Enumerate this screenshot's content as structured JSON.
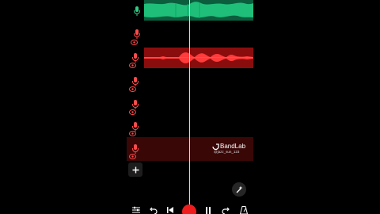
{
  "app": {
    "name": "BandLab",
    "watermark_handle": "@jazz_sun_123"
  },
  "colors": {
    "green_track": "#1fbf7a",
    "red_track": "#ff3b3b",
    "record": "#ee1c1c",
    "record_row": "#3a0707",
    "playhead": "#d9d9d9"
  },
  "tracks": [
    {
      "type": "green",
      "icons": [
        "mic-icon"
      ]
    },
    {
      "type": "red",
      "icons": [
        "mic-icon",
        "eye-icon"
      ]
    },
    {
      "type": "empty",
      "icons": [
        "mic-icon",
        "eye-icon"
      ]
    },
    {
      "type": "empty",
      "icons": [
        "mic-icon",
        "eye-icon"
      ]
    },
    {
      "type": "empty",
      "icons": [
        "mic-icon",
        "eye-icon"
      ]
    },
    {
      "type": "empty",
      "icons": [
        "mic-icon",
        "eye-icon"
      ]
    },
    {
      "type": "armed",
      "icons": [
        "mic-icon",
        "eye-icon"
      ]
    }
  ],
  "toolbar": {
    "items": [
      "mixer-icon",
      "undo-icon",
      "skip-back-icon",
      "record-icon",
      "pause-icon",
      "redo-icon",
      "metronome-icon"
    ]
  }
}
